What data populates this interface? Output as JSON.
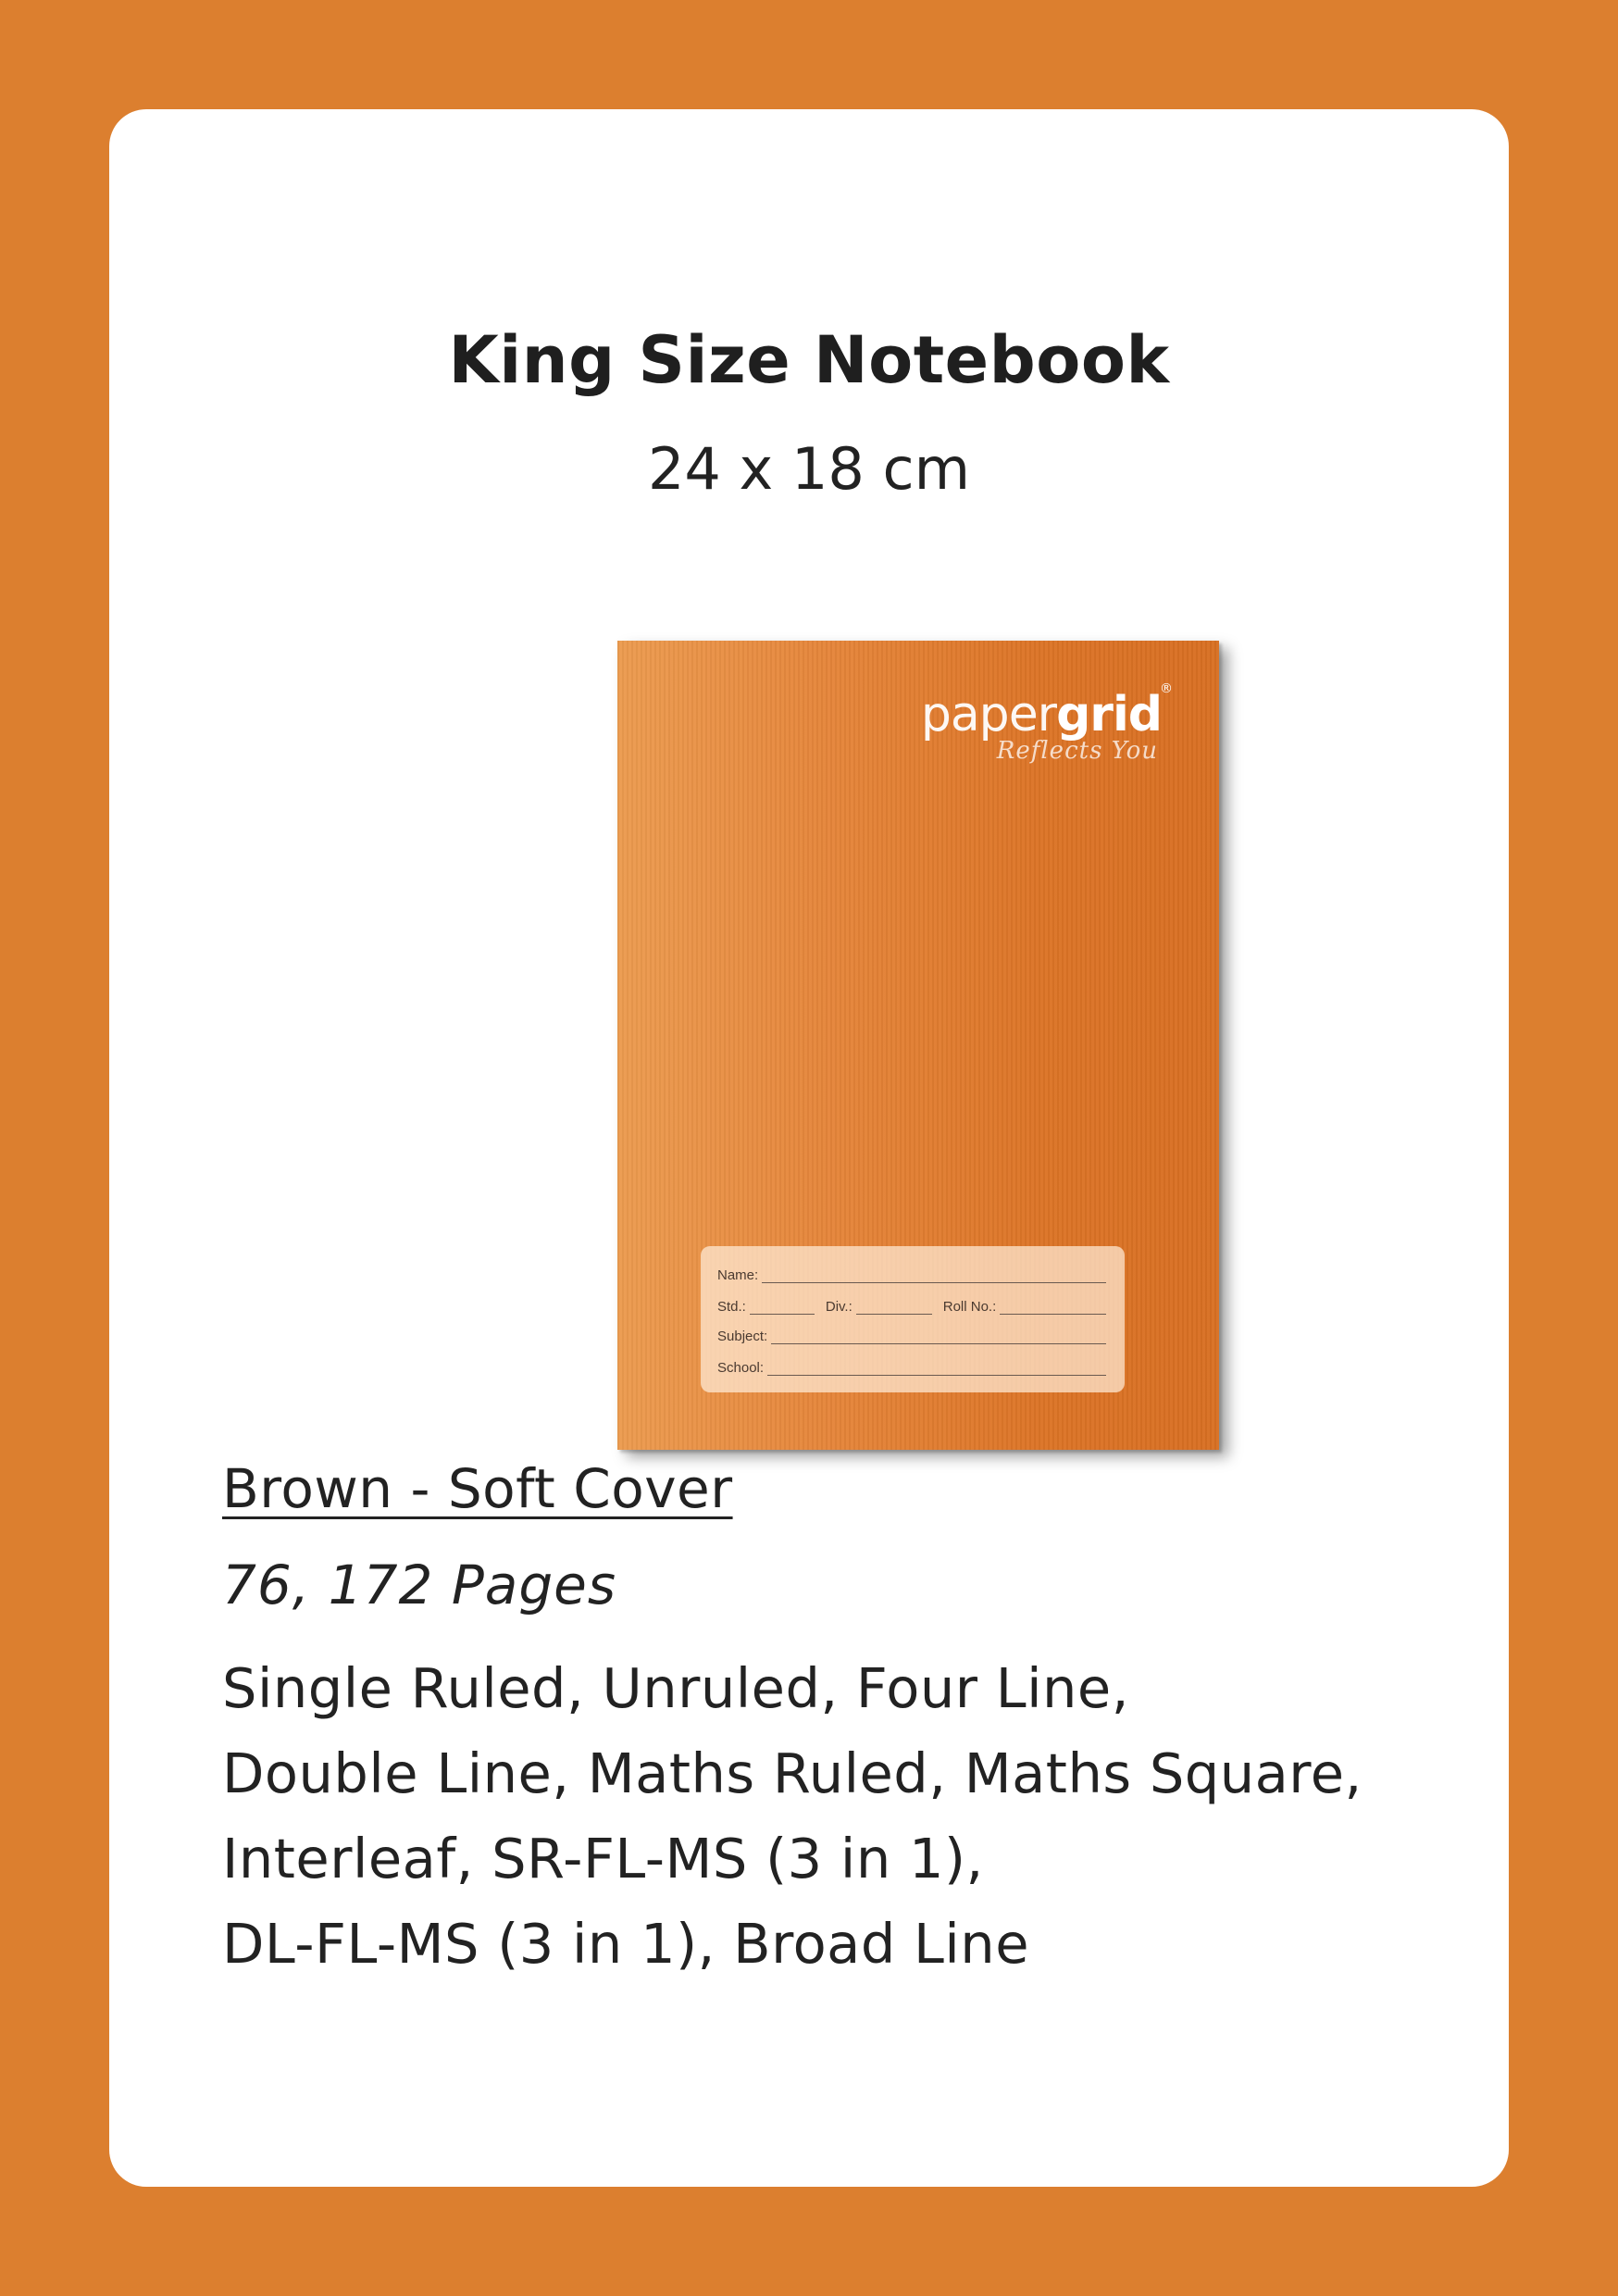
{
  "page": {
    "background_color": "#dc7f2f",
    "card_color": "#ffffff"
  },
  "header": {
    "title": "King Size Notebook",
    "size": "24 x 18 cm"
  },
  "notebook": {
    "cover_color": "#e5853a",
    "brand_part1": "paper",
    "brand_part2": "grid",
    "registered_mark": "®",
    "tagline": "Reflects You",
    "label": {
      "name": "Name:",
      "std": "Std.:",
      "div": "Div.:",
      "roll_no": "Roll No.:",
      "subject": "Subject:",
      "school": "School:"
    }
  },
  "details": {
    "cover_type": "Brown - Soft Cover",
    "pages": "76, 172 Pages",
    "rulings_lines": [
      "Single Ruled, Unruled, Four Line,",
      "Double Line, Maths Ruled, Maths Square,",
      "Interleaf, SR-FL-MS (3 in 1),",
      "DL-FL-MS (3 in 1), Broad Line"
    ]
  }
}
